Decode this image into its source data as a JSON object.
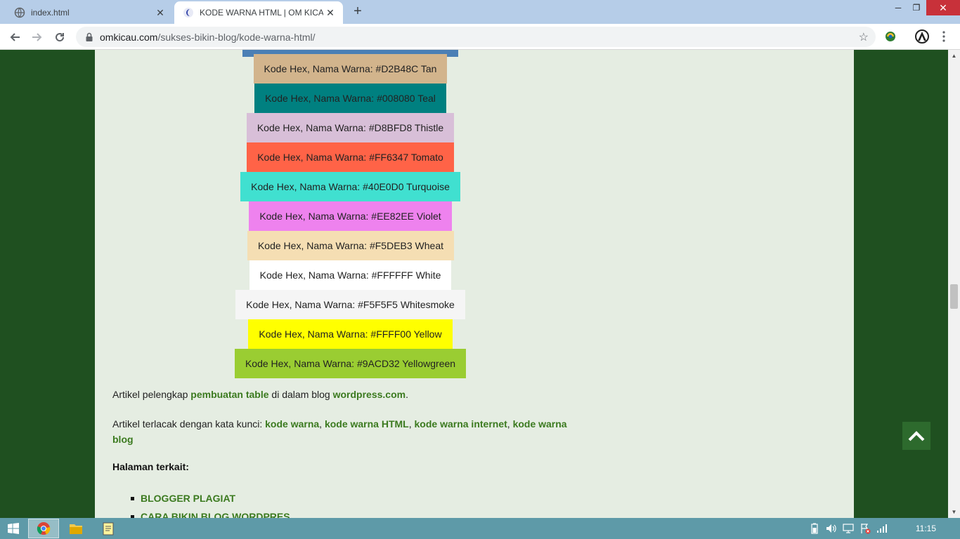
{
  "browser": {
    "tabs": [
      {
        "title": "index.html",
        "active": false
      },
      {
        "title": "KODE WARNA HTML | OM KICAU",
        "active": true
      }
    ],
    "url_host": "omkicau.com",
    "url_path": "/sukses-bikin-blog/kode-warna-html/"
  },
  "swatches": [
    {
      "label": "Kode Hex, Nama Warna: #D2B48C Tan",
      "color": "#D2B48C"
    },
    {
      "label": "Kode Hex, Nama Warna: #008080 Teal",
      "color": "#008080"
    },
    {
      "label": "Kode Hex, Nama Warna: #D8BFD8 Thistle",
      "color": "#D8BFD8"
    },
    {
      "label": "Kode Hex, Nama Warna: #FF6347 Tomato",
      "color": "#FF6347"
    },
    {
      "label": "Kode Hex, Nama Warna: #40E0D0 Turquoise",
      "color": "#40E0D0"
    },
    {
      "label": "Kode Hex, Nama Warna: #EE82EE Violet",
      "color": "#EE82EE"
    },
    {
      "label": "Kode Hex, Nama Warna: #F5DEB3 Wheat",
      "color": "#F5DEB3"
    },
    {
      "label": "Kode Hex, Nama Warna: #FFFFFF White",
      "color": "#FFFFFF"
    },
    {
      "label": "Kode Hex, Nama Warna: #F5F5F5 Whitesmoke",
      "color": "#F5F5F5"
    },
    {
      "label": "Kode Hex, Nama Warna: #FFFF00 Yellow",
      "color": "#FFFF00"
    },
    {
      "label": "Kode Hex, Nama Warna: #9ACD32 Yellowgreen",
      "color": "#9ACD32"
    }
  ],
  "article": {
    "p1_prefix": "Artikel pelengkap ",
    "p1_link1": "pembuatan table",
    "p1_middle": " di dalam blog ",
    "p1_link2": "wordpress.com",
    "p1_suffix": ".",
    "p2_prefix": "Artikel terlacak dengan kata kunci: ",
    "p2_links": [
      "kode warna",
      "kode warna HTML",
      "kode warna internet",
      "kode warna blog"
    ],
    "p2_sep": ", ",
    "related_heading": "Halaman terkait:",
    "related": [
      "BLOGGER PLAGIAT",
      "CARA BIKIN BLOG WORDPRES"
    ]
  },
  "taskbar": {
    "clock": "11:15"
  },
  "colors": {
    "page_bg": "#1f5020",
    "content_bg": "#e5ede2",
    "link": "#3b7a1f"
  }
}
